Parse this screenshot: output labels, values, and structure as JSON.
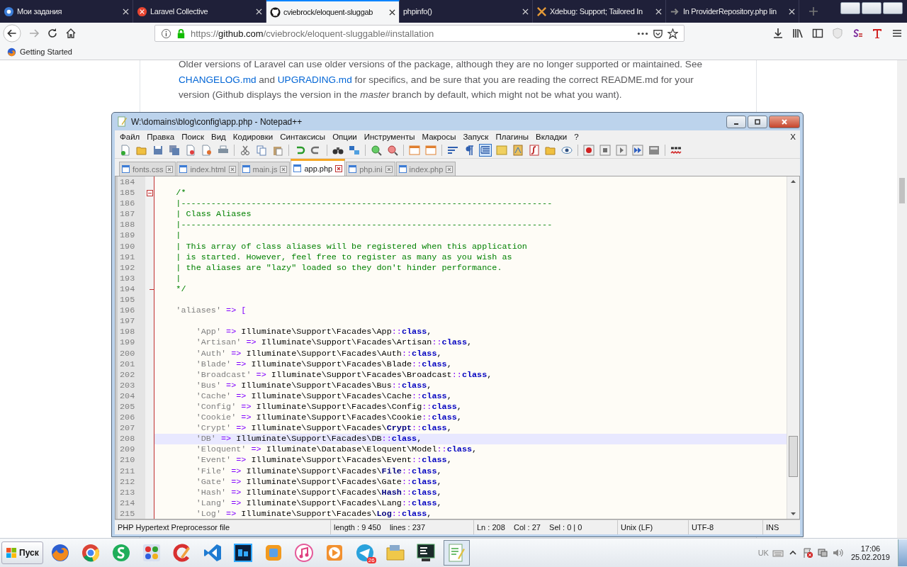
{
  "browser": {
    "tabs": [
      {
        "title": "Мои задания",
        "kind": "circle",
        "selected": false
      },
      {
        "title": "Laravel Collective",
        "kind": "red-circle",
        "selected": false
      },
      {
        "title": "cviebrock/eloquent-sluggab",
        "kind": "cat",
        "selected": true
      },
      {
        "title": "phpinfo()",
        "kind": "none",
        "selected": false
      },
      {
        "title": "Xdebug: Support; Tailored In",
        "kind": "cross",
        "selected": false
      },
      {
        "title": "In ProviderRepository.php lin",
        "kind": "arrow",
        "selected": false
      }
    ],
    "url": {
      "scheme": "https://",
      "host": "github.com",
      "path": "/cviebrock/eloquent-sluggable#installation"
    },
    "bookmarks": [
      {
        "label": "Getting Started"
      }
    ],
    "readme": [
      {
        "kind": "text",
        "t": "Older versions of Laravel can use older versions of the package, although they are no longer supported or maintained. See "
      },
      {
        "kind": "link",
        "t": "CHANGELOG.md"
      },
      {
        "kind": "text",
        "t": " and "
      },
      {
        "kind": "link",
        "t": "UPGRADING.md"
      },
      {
        "kind": "text",
        "t": " for specifics, and be sure that you are reading the correct README.md for your version (Github displays the version in the *master* branch by default, which might not be what you want)."
      }
    ]
  },
  "notepad": {
    "title": "W:\\domains\\blog\\config\\app.php - Notepad++",
    "menu": [
      "Файл",
      "Правка",
      "Поиск",
      "Вид",
      "Кодировки",
      "Синтаксисы",
      "Опции",
      "Инструменты",
      "Макросы",
      "Запуск",
      "Плагины",
      "Вкладки",
      "?"
    ],
    "menu_close": "X",
    "toolbar": [
      {
        "kind": "new-file",
        "pressed": false
      },
      {
        "kind": "open-folder",
        "pressed": false
      },
      {
        "kind": "save",
        "pressed": false
      },
      {
        "kind": "save-all",
        "pressed": false
      },
      {
        "kind": "close-file",
        "pressed": false
      },
      {
        "kind": "close-all",
        "pressed": false
      },
      {
        "kind": "printer",
        "pressed": false
      },
      {
        "kind": "separator"
      },
      {
        "kind": "scissors",
        "pressed": false
      },
      {
        "kind": "copy",
        "pressed": false
      },
      {
        "kind": "paste",
        "pressed": false
      },
      {
        "kind": "separator"
      },
      {
        "kind": "undo",
        "pressed": false
      },
      {
        "kind": "redo",
        "pressed": false
      },
      {
        "kind": "separator"
      },
      {
        "kind": "binoculars",
        "pressed": false
      },
      {
        "kind": "replace",
        "pressed": false
      },
      {
        "kind": "separator"
      },
      {
        "kind": "zoom-in",
        "pressed": false
      },
      {
        "kind": "zoom-out",
        "pressed": false
      },
      {
        "kind": "separator"
      },
      {
        "kind": "sync-vertical",
        "pressed": false
      },
      {
        "kind": "sync-horizontal",
        "pressed": false
      },
      {
        "kind": "separator"
      },
      {
        "kind": "word-wrap",
        "pressed": false
      },
      {
        "kind": "pilcrow",
        "pressed": false
      },
      {
        "kind": "indent-guide",
        "pressed": true
      },
      {
        "kind": "panel",
        "pressed": false
      },
      {
        "kind": "map",
        "pressed": false
      },
      {
        "kind": "function",
        "pressed": false
      },
      {
        "kind": "folder",
        "pressed": false
      },
      {
        "kind": "eye",
        "pressed": false
      },
      {
        "kind": "separator"
      },
      {
        "kind": "record",
        "pressed": false
      },
      {
        "kind": "stop",
        "pressed": false
      },
      {
        "kind": "play",
        "pressed": false
      },
      {
        "kind": "play-multiple",
        "pressed": false
      },
      {
        "kind": "save-macro",
        "pressed": false
      },
      {
        "kind": "separator"
      },
      {
        "kind": "spellcheck",
        "pressed": false
      }
    ],
    "tabs": [
      {
        "label": "fonts.css",
        "selected": false
      },
      {
        "label": "index.html",
        "selected": false
      },
      {
        "label": "main.js",
        "selected": false
      },
      {
        "label": "app.php",
        "selected": true
      },
      {
        "label": "php.ini",
        "selected": false
      },
      {
        "label": "index.php",
        "selected": false
      }
    ],
    "lines": [
      {
        "num": "184",
        "kind": "plain",
        "current": false
      },
      {
        "num": "185",
        "kind": "fold-start",
        "current": false,
        "tokens": [
          {
            "kind": "comment",
            "t": "    /*"
          }
        ]
      },
      {
        "num": "186",
        "kind": "plain",
        "current": false,
        "tokens": [
          {
            "kind": "comment",
            "t": "    |--------------------------------------------------------------------------"
          }
        ]
      },
      {
        "num": "187",
        "kind": "plain",
        "current": false,
        "tokens": [
          {
            "kind": "comment",
            "t": "    | Class Aliases"
          }
        ]
      },
      {
        "num": "188",
        "kind": "plain",
        "current": false,
        "tokens": [
          {
            "kind": "comment",
            "t": "    |--------------------------------------------------------------------------"
          }
        ]
      },
      {
        "num": "189",
        "kind": "plain",
        "current": false,
        "tokens": [
          {
            "kind": "comment",
            "t": "    |"
          }
        ]
      },
      {
        "num": "190",
        "kind": "plain",
        "current": false,
        "tokens": [
          {
            "kind": "comment",
            "t": "    | This array of class aliases will be registered when this application"
          }
        ]
      },
      {
        "num": "191",
        "kind": "plain",
        "current": false,
        "tokens": [
          {
            "kind": "comment",
            "t": "    | is started. However, feel free to register as many as you wish as"
          }
        ]
      },
      {
        "num": "192",
        "kind": "plain",
        "current": false,
        "tokens": [
          {
            "kind": "comment",
            "t": "    | the aliases are \"lazy\" loaded so they don't hinder performance."
          }
        ]
      },
      {
        "num": "193",
        "kind": "plain",
        "current": false,
        "tokens": [
          {
            "kind": "comment",
            "t": "    |"
          }
        ]
      },
      {
        "num": "194",
        "kind": "fold-end",
        "current": false,
        "tokens": [
          {
            "kind": "comment",
            "t": "    */"
          }
        ]
      },
      {
        "num": "195",
        "kind": "plain",
        "current": false
      },
      {
        "num": "196",
        "kind": "plain",
        "current": false,
        "tokens": [
          {
            "kind": "string",
            "t": "    'aliases'"
          },
          {
            "kind": "operator",
            "t": " => ["
          }
        ]
      },
      {
        "num": "197",
        "kind": "plain",
        "current": false
      },
      {
        "num": "198",
        "kind": "plain",
        "current": false,
        "tokens": [
          {
            "kind": "string",
            "t": "        'App'"
          },
          {
            "kind": "operator",
            "t": " => "
          },
          {
            "kind": "name",
            "t": "Illuminate\\Support\\Facades\\App"
          },
          {
            "kind": "operator",
            "t": "::"
          },
          {
            "kind": "keyword",
            "t": "class"
          },
          {
            "kind": "name",
            "t": ","
          }
        ]
      },
      {
        "num": "199",
        "kind": "plain",
        "current": false,
        "tokens": [
          {
            "kind": "string",
            "t": "        'Artisan'"
          },
          {
            "kind": "operator",
            "t": " => "
          },
          {
            "kind": "name",
            "t": "Illuminate\\Support\\Facades\\Artisan"
          },
          {
            "kind": "operator",
            "t": "::"
          },
          {
            "kind": "keyword",
            "t": "class"
          },
          {
            "kind": "name",
            "t": ","
          }
        ]
      },
      {
        "num": "200",
        "kind": "plain",
        "current": false,
        "tokens": [
          {
            "kind": "string",
            "t": "        'Auth'"
          },
          {
            "kind": "operator",
            "t": " => "
          },
          {
            "kind": "name",
            "t": "Illuminate\\Support\\Facades\\Auth"
          },
          {
            "kind": "operator",
            "t": "::"
          },
          {
            "kind": "keyword",
            "t": "class"
          },
          {
            "kind": "name",
            "t": ","
          }
        ]
      },
      {
        "num": "201",
        "kind": "plain",
        "current": false,
        "tokens": [
          {
            "kind": "string",
            "t": "        'Blade'"
          },
          {
            "kind": "operator",
            "t": " => "
          },
          {
            "kind": "name",
            "t": "Illuminate\\Support\\Facades\\Blade"
          },
          {
            "kind": "operator",
            "t": "::"
          },
          {
            "kind": "keyword",
            "t": "class"
          },
          {
            "kind": "name",
            "t": ","
          }
        ]
      },
      {
        "num": "202",
        "kind": "plain",
        "current": false,
        "tokens": [
          {
            "kind": "string",
            "t": "        'Broadcast'"
          },
          {
            "kind": "operator",
            "t": " => "
          },
          {
            "kind": "name",
            "t": "Illuminate\\Support\\Facades\\Broadcast"
          },
          {
            "kind": "operator",
            "t": "::"
          },
          {
            "kind": "keyword",
            "t": "class"
          },
          {
            "kind": "name",
            "t": ","
          }
        ]
      },
      {
        "num": "203",
        "kind": "plain",
        "current": false,
        "tokens": [
          {
            "kind": "string",
            "t": "        'Bus'"
          },
          {
            "kind": "operator",
            "t": " => "
          },
          {
            "kind": "name",
            "t": "Illuminate\\Support\\Facades\\Bus"
          },
          {
            "kind": "operator",
            "t": "::"
          },
          {
            "kind": "keyword",
            "t": "class"
          },
          {
            "kind": "name",
            "t": ","
          }
        ]
      },
      {
        "num": "204",
        "kind": "plain",
        "current": false,
        "tokens": [
          {
            "kind": "string",
            "t": "        'Cache'"
          },
          {
            "kind": "operator",
            "t": " => "
          },
          {
            "kind": "name",
            "t": "Illuminate\\Support\\Facades\\Cache"
          },
          {
            "kind": "operator",
            "t": "::"
          },
          {
            "kind": "keyword",
            "t": "class"
          },
          {
            "kind": "name",
            "t": ","
          }
        ]
      },
      {
        "num": "205",
        "kind": "plain",
        "current": false,
        "tokens": [
          {
            "kind": "string",
            "t": "        'Config'"
          },
          {
            "kind": "operator",
            "t": " => "
          },
          {
            "kind": "name",
            "t": "Illuminate\\Support\\Facades\\Config"
          },
          {
            "kind": "operator",
            "t": "::"
          },
          {
            "kind": "keyword",
            "t": "class"
          },
          {
            "kind": "name",
            "t": ","
          }
        ]
      },
      {
        "num": "206",
        "kind": "plain",
        "current": false,
        "tokens": [
          {
            "kind": "string",
            "t": "        'Cookie'"
          },
          {
            "kind": "operator",
            "t": " => "
          },
          {
            "kind": "name",
            "t": "Illuminate\\Support\\Facades\\Cookie"
          },
          {
            "kind": "operator",
            "t": "::"
          },
          {
            "kind": "keyword",
            "t": "class"
          },
          {
            "kind": "name",
            "t": ","
          }
        ]
      },
      {
        "num": "207",
        "kind": "plain",
        "current": false,
        "tokens": [
          {
            "kind": "string",
            "t": "        'Crypt'"
          },
          {
            "kind": "operator",
            "t": " => "
          },
          {
            "kind": "name",
            "t": "Illuminate\\Support\\Facades\\"
          },
          {
            "kind": "known-class",
            "t": "Crypt"
          },
          {
            "kind": "operator",
            "t": "::"
          },
          {
            "kind": "keyword",
            "t": "class"
          },
          {
            "kind": "name",
            "t": ","
          }
        ]
      },
      {
        "num": "208",
        "kind": "plain",
        "current": true,
        "tokens": [
          {
            "kind": "string",
            "t": "        'DB'"
          },
          {
            "kind": "operator",
            "t": " => "
          },
          {
            "kind": "name",
            "t": "Illuminate\\Support\\Facades\\DB"
          },
          {
            "kind": "operator",
            "t": "::"
          },
          {
            "kind": "keyword",
            "t": "class"
          },
          {
            "kind": "name",
            "t": ","
          }
        ]
      },
      {
        "num": "209",
        "kind": "plain",
        "current": false,
        "tokens": [
          {
            "kind": "string",
            "t": "        'Eloquent'"
          },
          {
            "kind": "operator",
            "t": " => "
          },
          {
            "kind": "name",
            "t": "Illuminate\\Database\\Eloquent\\Model"
          },
          {
            "kind": "operator",
            "t": "::"
          },
          {
            "kind": "keyword",
            "t": "class"
          },
          {
            "kind": "name",
            "t": ","
          }
        ]
      },
      {
        "num": "210",
        "kind": "plain",
        "current": false,
        "tokens": [
          {
            "kind": "string",
            "t": "        'Event'"
          },
          {
            "kind": "operator",
            "t": " => "
          },
          {
            "kind": "name",
            "t": "Illuminate\\Support\\Facades\\Event"
          },
          {
            "kind": "operator",
            "t": "::"
          },
          {
            "kind": "keyword",
            "t": "class"
          },
          {
            "kind": "name",
            "t": ","
          }
        ]
      },
      {
        "num": "211",
        "kind": "plain",
        "current": false,
        "tokens": [
          {
            "kind": "string",
            "t": "        'File'"
          },
          {
            "kind": "operator",
            "t": " => "
          },
          {
            "kind": "name",
            "t": "Illuminate\\Support\\Facades\\"
          },
          {
            "kind": "known-class",
            "t": "File"
          },
          {
            "kind": "operator",
            "t": "::"
          },
          {
            "kind": "keyword",
            "t": "class"
          },
          {
            "kind": "name",
            "t": ","
          }
        ]
      },
      {
        "num": "212",
        "kind": "plain",
        "current": false,
        "tokens": [
          {
            "kind": "string",
            "t": "        'Gate'"
          },
          {
            "kind": "operator",
            "t": " => "
          },
          {
            "kind": "name",
            "t": "Illuminate\\Support\\Facades\\Gate"
          },
          {
            "kind": "operator",
            "t": "::"
          },
          {
            "kind": "keyword",
            "t": "class"
          },
          {
            "kind": "name",
            "t": ","
          }
        ]
      },
      {
        "num": "213",
        "kind": "plain",
        "current": false,
        "tokens": [
          {
            "kind": "string",
            "t": "        'Hash'"
          },
          {
            "kind": "operator",
            "t": " => "
          },
          {
            "kind": "name",
            "t": "Illuminate\\Support\\Facades\\"
          },
          {
            "kind": "known-class",
            "t": "Hash"
          },
          {
            "kind": "operator",
            "t": "::"
          },
          {
            "kind": "keyword",
            "t": "class"
          },
          {
            "kind": "name",
            "t": ","
          }
        ]
      },
      {
        "num": "214",
        "kind": "plain",
        "current": false,
        "tokens": [
          {
            "kind": "string",
            "t": "        'Lang'"
          },
          {
            "kind": "operator",
            "t": " => "
          },
          {
            "kind": "name",
            "t": "Illuminate\\Support\\Facades\\Lang"
          },
          {
            "kind": "operator",
            "t": "::"
          },
          {
            "kind": "keyword",
            "t": "class"
          },
          {
            "kind": "name",
            "t": ","
          }
        ]
      },
      {
        "num": "215",
        "kind": "plain",
        "current": false,
        "tokens": [
          {
            "kind": "string",
            "t": "        'Log'"
          },
          {
            "kind": "operator",
            "t": " => "
          },
          {
            "kind": "name",
            "t": "Illuminate\\Support\\Facades\\"
          },
          {
            "kind": "known-class",
            "t": "Log"
          },
          {
            "kind": "operator",
            "t": "::"
          },
          {
            "kind": "keyword",
            "t": "class"
          },
          {
            "kind": "name",
            "t": ","
          }
        ]
      }
    ],
    "status": [
      "PHP Hypertext Preprocessor file",
      "length : 9 450    lines : 237",
      "Ln : 208    Col : 27    Sel : 0 | 0",
      "Unix (LF)",
      "UTF-8",
      "INS"
    ]
  },
  "taskbar": {
    "start": "Пуск",
    "apps": [
      {
        "kind": "globe",
        "selected": false
      },
      {
        "kind": "ring",
        "selected": false
      },
      {
        "kind": "circle",
        "selected": false
      },
      {
        "kind": "tiles",
        "selected": false
      },
      {
        "kind": "brush",
        "selected": false
      },
      {
        "kind": "ribbon",
        "selected": false
      },
      {
        "kind": "square",
        "selected": false
      },
      {
        "kind": "box",
        "selected": false
      },
      {
        "kind": "music-note",
        "selected": false
      },
      {
        "kind": "play",
        "selected": false
      },
      {
        "kind": "paper-plane",
        "selected": false,
        "badge": "26"
      },
      {
        "kind": "folder",
        "selected": false
      },
      {
        "kind": "terminal",
        "selected": false
      },
      {
        "kind": "notepad",
        "selected": true
      }
    ],
    "language": "UK",
    "time": "17:06",
    "date": "25.02.2019"
  }
}
